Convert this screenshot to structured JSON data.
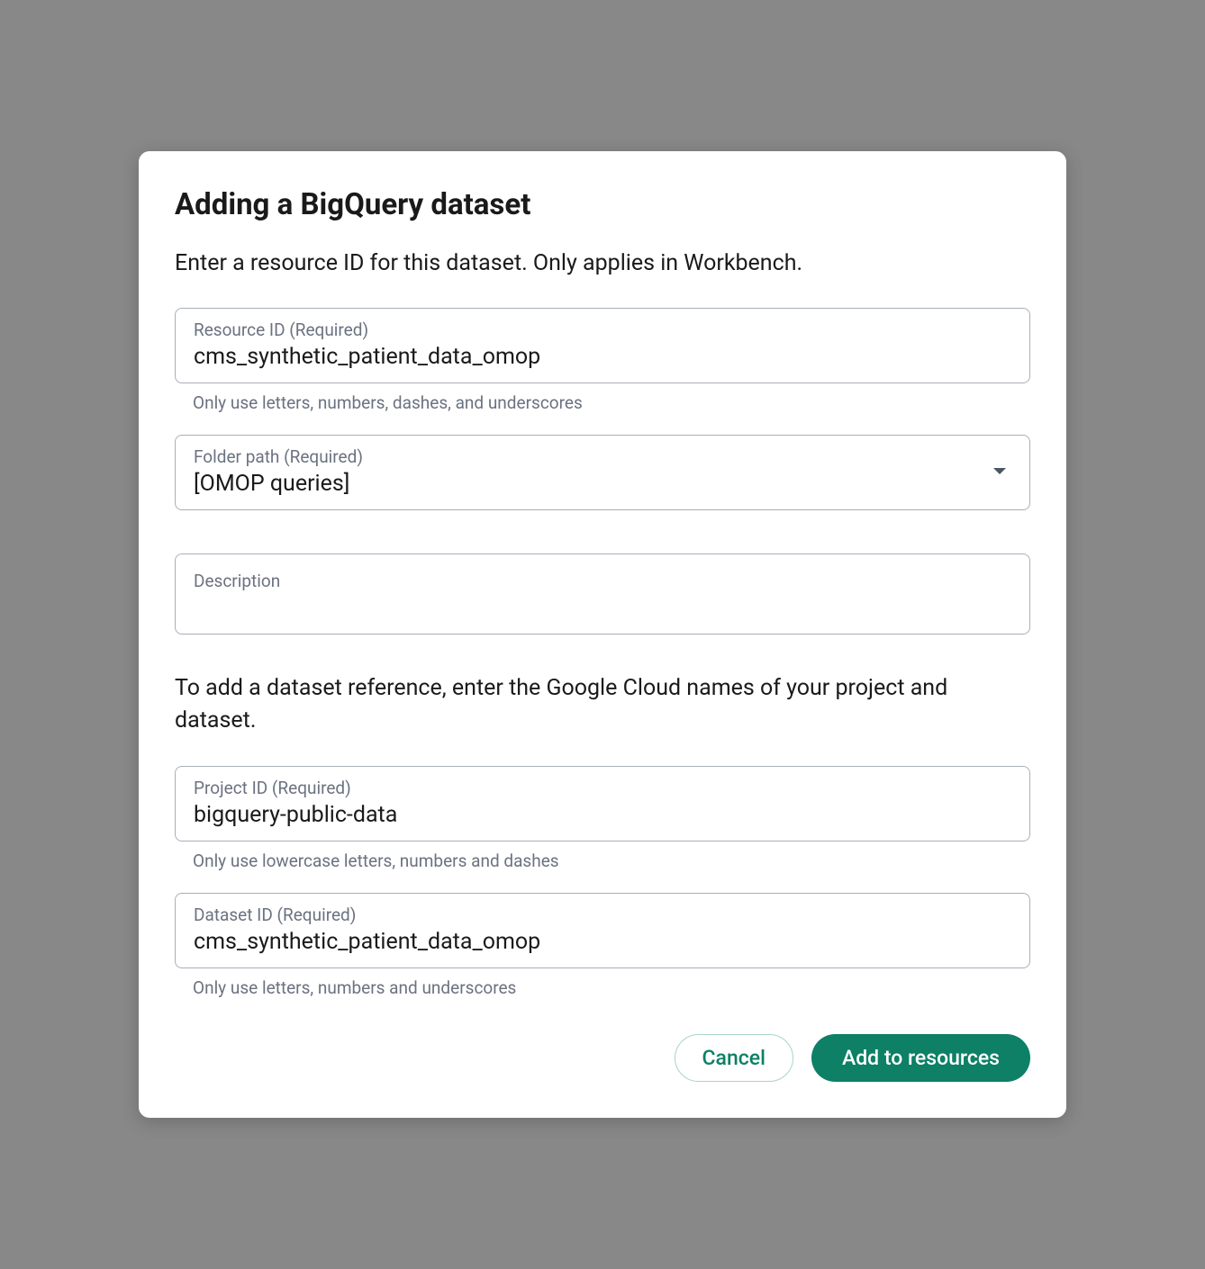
{
  "dialog": {
    "title": "Adding a BigQuery dataset",
    "subtitle": "Enter a resource ID for this dataset. Only applies in Workbench.",
    "section2_text": "To add a dataset reference, enter the Google Cloud names of your project and dataset."
  },
  "fields": {
    "resource_id": {
      "label": "Resource ID (Required)",
      "value": "cms_synthetic_patient_data_omop",
      "helper": "Only use letters, numbers, dashes, and underscores"
    },
    "folder_path": {
      "label": "Folder path (Required)",
      "value": "[OMOP queries]"
    },
    "description": {
      "label": "Description",
      "value": ""
    },
    "project_id": {
      "label": "Project ID (Required)",
      "value": "bigquery-public-data",
      "helper": "Only use lowercase letters, numbers and dashes"
    },
    "dataset_id": {
      "label": "Dataset ID (Required)",
      "value": "cms_synthetic_patient_data_omop",
      "helper": "Only use letters, numbers and underscores"
    }
  },
  "buttons": {
    "cancel": "Cancel",
    "submit": "Add to resources"
  }
}
